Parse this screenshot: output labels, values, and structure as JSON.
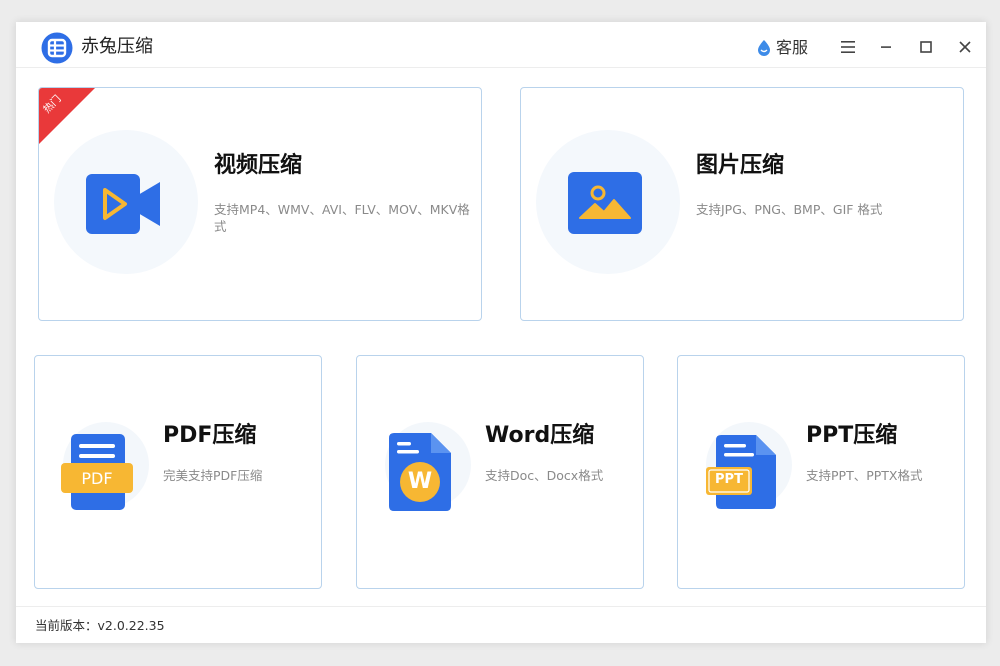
{
  "app": {
    "title": "赤兔压缩",
    "customer_service_label": "客服",
    "version_text": "当前版本：v2.0.22.35"
  },
  "colors": {
    "brand_blue": "#2e6ee6",
    "ribbon_red": "#e9393a",
    "pdf_orange": "#f7b733",
    "card_border": "#b9d3ec"
  },
  "cards": {
    "video": {
      "title": "视频压缩",
      "desc": "支持MP4、WMV、AVI、FLV、MOV、MKV格式",
      "badge": "热门",
      "icon": "video-icon"
    },
    "image": {
      "title": "图片压缩",
      "desc": "支持JPG、PNG、BMP、GIF 格式",
      "icon": "image-icon"
    },
    "pdf": {
      "title": "PDF压缩",
      "desc": "完美支持PDF压缩",
      "icon_text": "PDF",
      "icon": "pdf-file-icon"
    },
    "word": {
      "title": "Word压缩",
      "desc": "支持Doc、Docx格式",
      "icon_text": "W",
      "icon": "word-file-icon"
    },
    "ppt": {
      "title": "PPT压缩",
      "desc": "支持PPT、PPTX格式",
      "icon_text": "PPT",
      "icon": "ppt-file-icon"
    }
  }
}
